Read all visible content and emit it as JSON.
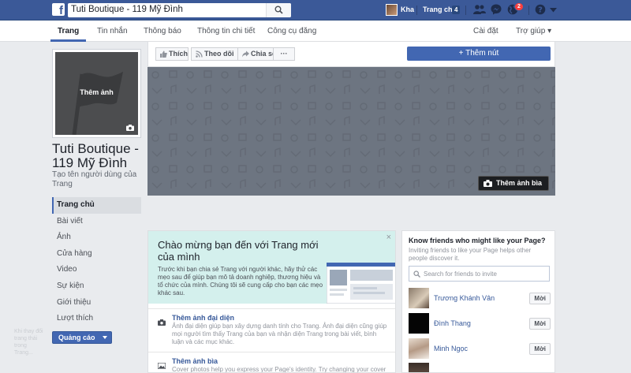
{
  "topbar": {
    "search_value": "Tuti Boutique - 119 Mỹ Đình",
    "user_name": "Kha",
    "home_label": "Trang chủ",
    "home_count": "4",
    "notifications_count": "2"
  },
  "page_nav": {
    "tabs": [
      {
        "label": "Trang"
      },
      {
        "label": "Tin nhắn"
      },
      {
        "label": "Thông báo"
      },
      {
        "label": "Thông tin chi tiết"
      },
      {
        "label": "Công cụ đăng"
      }
    ],
    "settings_label": "Cài đặt",
    "help_label": "Trợ giúp ▾"
  },
  "profile": {
    "add_photo_label": "Thêm ảnh",
    "page_name": "Tuti Boutique - 119 Mỹ Đình",
    "username_hint": "Tạo tên người dùng của Trang"
  },
  "sidebar": {
    "items": [
      {
        "label": "Trang chủ"
      },
      {
        "label": "Bài viết"
      },
      {
        "label": "Ảnh"
      },
      {
        "label": "Cửa hàng"
      },
      {
        "label": "Video"
      },
      {
        "label": "Sự kiện"
      },
      {
        "label": "Giới thiệu"
      },
      {
        "label": "Lượt thích"
      }
    ],
    "promote_label": "Quảng cáo"
  },
  "actions": {
    "like_label": "Thích",
    "follow_label": "Theo dõi",
    "share_label": "Chia sẻ",
    "more_label": "···",
    "add_button_label": "+ Thêm nút"
  },
  "cover": {
    "add_cover_label": "Thêm ảnh bìa"
  },
  "welcome": {
    "title": "Chào mừng bạn đến với Trang mới của mình",
    "text": "Trước khi bạn chia sẻ Trang với người khác, hãy thử các mẹo sau để giúp bạn mô tả doanh nghiệp, thương hiệu và tổ chức của mình. Chúng tôi sẽ cung cấp cho bạn các mẹo khác sau.",
    "close": "×",
    "tips": [
      {
        "title": "Thêm ảnh đại diện",
        "text": "Ảnh đại diện giúp bạn xây dựng danh tính cho Trang. Ảnh đại diện cũng giúp mọi người tìm thấy Trang của bạn và nhận diện Trang trong bài viết, bình luận và các mục khác."
      },
      {
        "title": "Thêm ảnh bìa",
        "text": "Cover photos help you express your Page's identity. Try changing your cover photo"
      }
    ]
  },
  "friends": {
    "title": "Know friends who might like your Page?",
    "subtitle": "Inviting friends to like your Page helps other people discover it.",
    "search_placeholder": "Search for friends to invite",
    "invite_label": "Mời",
    "list": [
      {
        "name": "Trương Khánh Vân"
      },
      {
        "name": "Đình Thang"
      },
      {
        "name": "Minh Ngọc"
      }
    ]
  },
  "chat_hint": "Khi thay đổi trang thái trong Trang..."
}
